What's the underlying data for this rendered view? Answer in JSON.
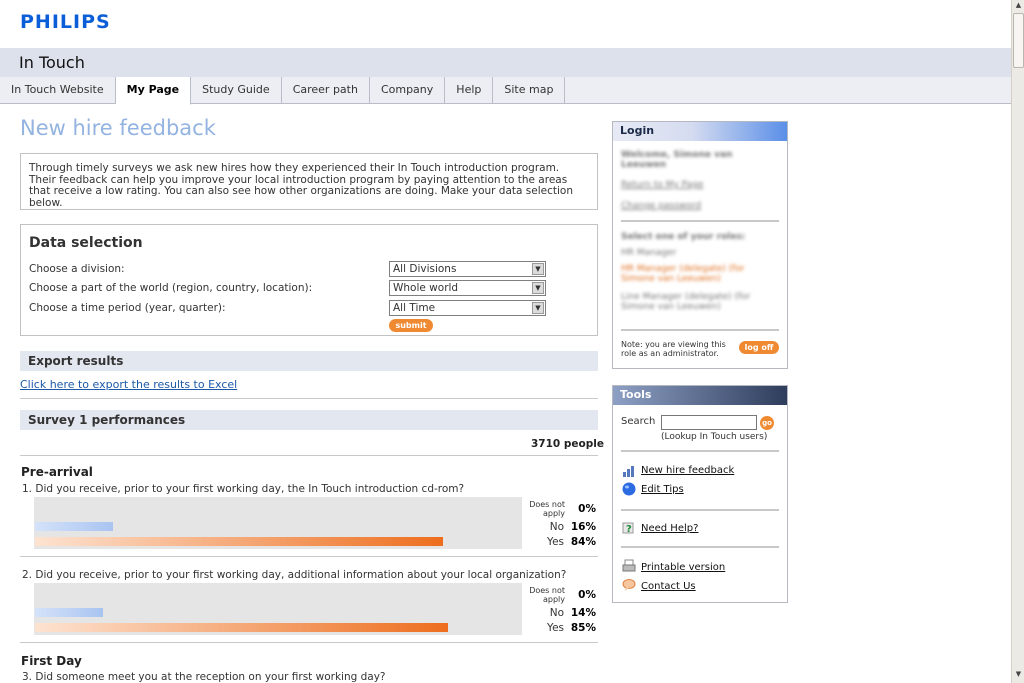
{
  "brand": {
    "logo_text": "PHILIPS",
    "app_title": "In Touch"
  },
  "nav": {
    "tabs": [
      {
        "label": "In Touch Website"
      },
      {
        "label": "My Page"
      },
      {
        "label": "Study Guide"
      },
      {
        "label": "Career path"
      },
      {
        "label": "Company"
      },
      {
        "label": "Help"
      },
      {
        "label": "Site map"
      }
    ],
    "active": "My Page"
  },
  "page": {
    "title": "New hire feedback",
    "intro": "Through timely surveys we ask new hires how they experienced their In Touch introduction program. Their feedback can help you improve your local introduction program by paying attention to the areas that receive a low rating. You can also see how other organizations are doing. Make your data selection below."
  },
  "data_selection": {
    "title": "Data selection",
    "rows": [
      {
        "label": "Choose a division:",
        "value": "All Divisions"
      },
      {
        "label": "Choose a part of the world (region, country, location):",
        "value": "Whole world"
      },
      {
        "label": "Choose a time period (year, quarter):",
        "value": "All Time"
      }
    ],
    "submit_label": "submit"
  },
  "export": {
    "title": "Export results",
    "link": "Click here to export the results to Excel"
  },
  "survey": {
    "title": "Survey 1 performances",
    "people": "3710 people",
    "sections": [
      {
        "name": "Pre-arrival",
        "questions": [
          {
            "text": "1. Did you receive, prior to your first working day, the In Touch introduction cd-rom?",
            "answers": [
              {
                "label": "Does not apply",
                "pct": "0%",
                "value": 0
              },
              {
                "label": "No",
                "pct": "16%",
                "value": 16
              },
              {
                "label": "Yes",
                "pct": "84%",
                "value": 84
              }
            ]
          },
          {
            "text": "2. Did you receive, prior to your first working day, additional information about your local organization?",
            "answers": [
              {
                "label": "Does not apply",
                "pct": "0%",
                "value": 0
              },
              {
                "label": "No",
                "pct": "14%",
                "value": 14
              },
              {
                "label": "Yes",
                "pct": "85%",
                "value": 85
              }
            ]
          }
        ]
      },
      {
        "name": "First Day",
        "questions": [
          {
            "text": "3.   Did someone meet you at the reception on your first working day?"
          }
        ]
      }
    ]
  },
  "login": {
    "title": "Login",
    "welcome": "Welcome, Simone van Leeuwen",
    "link1": "Return to My Page",
    "link2": "Change password",
    "roles_title": "Select one of your roles:",
    "role1": "HR Manager",
    "role2": "HR Manager (delegate) (for Simone van Leeuwen)",
    "role3": "Line Manager (delegate) (for Simone van Leeuwen)",
    "note": "Note: you are viewing this role as an administrator.",
    "logoff_label": "log off"
  },
  "tools": {
    "title": "Tools",
    "search_label": "Search",
    "search_value": "",
    "go_label": "go",
    "search_hint": "(Lookup In Touch users)",
    "links": [
      {
        "label": "New hire feedback",
        "icon": "bar-chart-icon"
      },
      {
        "label": "Edit Tips",
        "icon": "globe-icon"
      },
      {
        "label": "Need Help?",
        "icon": "question-icon"
      },
      {
        "label": "Printable version",
        "icon": "printer-icon"
      },
      {
        "label": "Contact Us",
        "icon": "speech-bubble-icon"
      }
    ]
  },
  "colors": {
    "brand_blue": "#0b5ed7",
    "accent_orange": "#f08a32",
    "title_blue": "#93b3e0"
  }
}
